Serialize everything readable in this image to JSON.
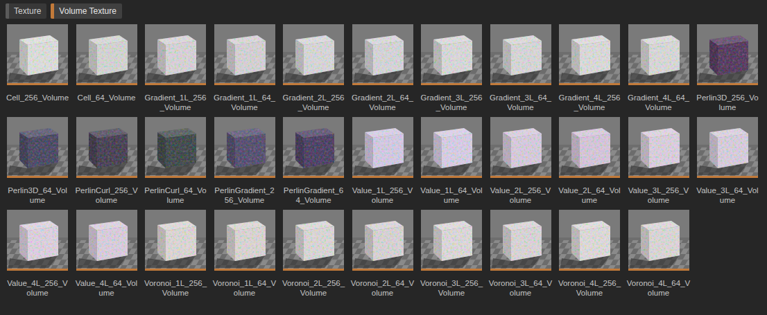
{
  "filters": [
    {
      "label": "Texture",
      "selected": false,
      "color": "#5a5a5a"
    },
    {
      "label": "Volume Texture",
      "selected": true,
      "color": "#c27a3a"
    }
  ],
  "assets": [
    {
      "name": "Cell_256_Volume",
      "color": "#e2e2e2"
    },
    {
      "name": "Cell_64_Volume",
      "color": "#d8d8d8"
    },
    {
      "name": "Gradient_1L_256_Volume",
      "color": "#dcd6dc"
    },
    {
      "name": "Gradient_1L_64_Volume",
      "color": "#dad4da"
    },
    {
      "name": "Gradient_2L_256_Volume",
      "color": "#dcdadf"
    },
    {
      "name": "Gradient_2L_64_Volume",
      "color": "#dad8de"
    },
    {
      "name": "Gradient_3L_256_Volume",
      "color": "#dedcdf"
    },
    {
      "name": "Gradient_3L_64_Volume",
      "color": "#dcdadd"
    },
    {
      "name": "Gradient_4L_256_Volume",
      "color": "#e0dee0"
    },
    {
      "name": "Gradient_4L_64_Volume",
      "color": "#dedcde"
    },
    {
      "name": "Perlin3D_256_Volume",
      "color": "#4a2a55"
    },
    {
      "name": "Perlin3D_64_Volume",
      "color": "#3e3a5a"
    },
    {
      "name": "PerlinCurl_256_Volume",
      "color": "#3a3048"
    },
    {
      "name": "PerlinCurl_64_Volume",
      "color": "#323a40"
    },
    {
      "name": "PerlinGradient_256_Volume",
      "color": "#4a4068"
    },
    {
      "name": "PerlinGradient_64_Volume",
      "color": "#40305a"
    },
    {
      "name": "Value_1L_256_Volume",
      "color": "#d8ccea"
    },
    {
      "name": "Value_1L_64_Volume",
      "color": "#dcd0ec"
    },
    {
      "name": "Value_2L_256_Volume",
      "color": "#dccde4"
    },
    {
      "name": "Value_2L_64_Volume",
      "color": "#dac8e0"
    },
    {
      "name": "Value_3L_256_Volume",
      "color": "#e0d2e4"
    },
    {
      "name": "Value_3L_64_Volume",
      "color": "#ddd0e4"
    },
    {
      "name": "Value_4L_256_Volume",
      "color": "#e2d4e6"
    },
    {
      "name": "Value_4L_64_Volume",
      "color": "#dfd0e4"
    },
    {
      "name": "Voronoi_1L_256_Volume",
      "color": "#e2dada"
    },
    {
      "name": "Voronoi_1L_64_Volume",
      "color": "#e0d8d8"
    },
    {
      "name": "Voronoi_2L_256_Volume",
      "color": "#e0dadc"
    },
    {
      "name": "Voronoi_2L_64_Volume",
      "color": "#ddd6da"
    },
    {
      "name": "Voronoi_3L_256_Volume",
      "color": "#e2dce0"
    },
    {
      "name": "Voronoi_3L_64_Volume",
      "color": "#dfd8dc"
    },
    {
      "name": "Voronoi_4L_256_Volume",
      "color": "#e4dee0"
    },
    {
      "name": "Voronoi_4L_64_Volume",
      "color": "#e0dadc"
    }
  ]
}
